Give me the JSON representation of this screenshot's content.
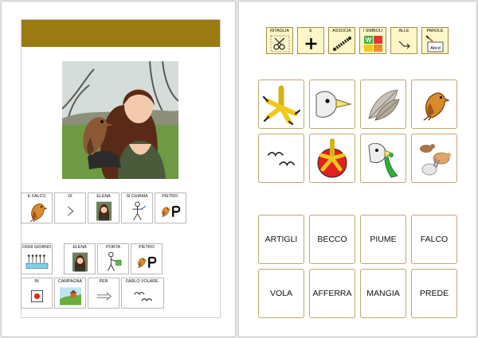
{
  "left_page": {
    "sentence_row_1": [
      {
        "label": "IL FALCO",
        "icon": "falcon-icon"
      },
      {
        "label": "DI",
        "icon": "chevron-right-icon"
      },
      {
        "label": "ELENA",
        "icon": "elena-portrait-icon"
      },
      {
        "label": "SI CHIAMA",
        "icon": "person-icon"
      },
      {
        "label": "PIETRO.",
        "icon": "falcon-p-icon"
      }
    ],
    "sentence_row_2": [
      {
        "label": "OGNI GIORNO",
        "icon": "calendar-icon"
      },
      {
        "label": "ELENA",
        "icon": "elena-portrait-icon"
      },
      {
        "label": "PORTA",
        "icon": "carry-icon"
      },
      {
        "label": "PIETRO",
        "icon": "falcon-p-icon"
      }
    ],
    "sentence_row_3": [
      {
        "label": "IN",
        "icon": "in-icon"
      },
      {
        "label": "CAMPAGNA",
        "icon": "countryside-icon"
      },
      {
        "label": "PER",
        "icon": "arrow-right-icon"
      },
      {
        "label": "FARLO VOLARE.",
        "icon": "birds-flying-icon"
      }
    ]
  },
  "right_page": {
    "toolbar": [
      {
        "label": "RITAGLIA",
        "icon": "scissors-icon"
      },
      {
        "label": "E",
        "icon": "plus-icon"
      },
      {
        "label": "ASSOCIA",
        "icon": "connect-icon"
      },
      {
        "label": "I SIMBOLI",
        "icon": "symbols-icon"
      },
      {
        "label": "ALLE",
        "icon": "arrow-down-right-icon"
      },
      {
        "label": "PAROLE",
        "icon": "write-words-icon"
      }
    ],
    "picture_tiles": [
      {
        "name": "talons",
        "icon": "talons-icon"
      },
      {
        "name": "beak",
        "icon": "beak-icon"
      },
      {
        "name": "feathers",
        "icon": "feathers-icon"
      },
      {
        "name": "falcon",
        "icon": "falcon-icon"
      },
      {
        "name": "flies",
        "icon": "birds-flying-icon"
      },
      {
        "name": "grabs",
        "icon": "grab-icon"
      },
      {
        "name": "eats",
        "icon": "bird-eating-icon"
      },
      {
        "name": "prey",
        "icon": "prey-animals-icon"
      }
    ],
    "word_tiles": [
      "ARTIGLI",
      "BECCO",
      "PIUME",
      "FALCO",
      "VOLA",
      "AFFERRA",
      "MANGIA",
      "PREDE"
    ]
  },
  "colors": {
    "header_band": "#9a7b12",
    "toolbar_fill": "#fff6c9",
    "tile_border": "#bda86c"
  }
}
